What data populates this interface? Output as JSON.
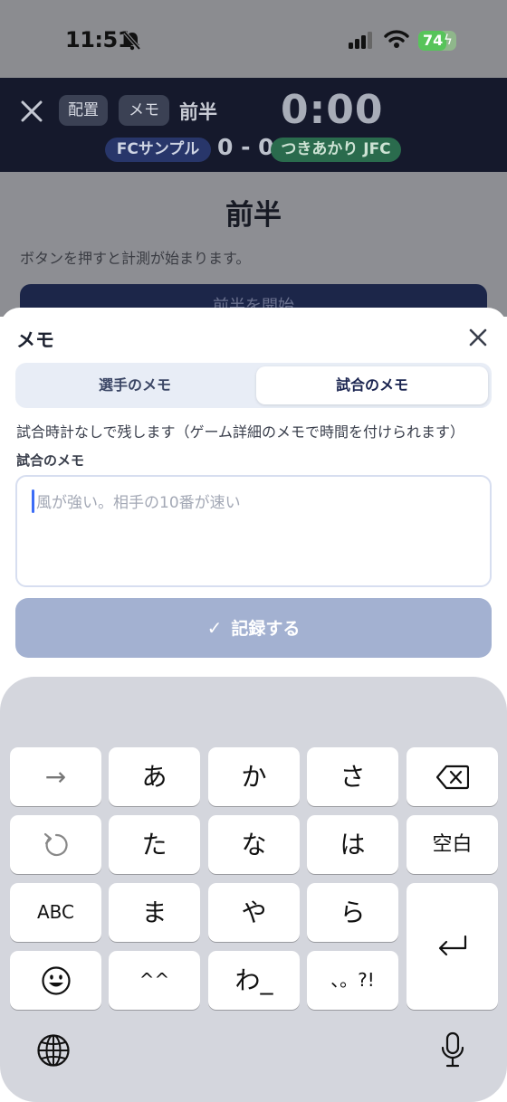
{
  "status_bar": {
    "time": "11:51",
    "battery": "74",
    "battery_fraction": 0.74
  },
  "match_header": {
    "lineup_button": "配置",
    "memo_button": "メモ",
    "period": "前半",
    "clock": "0:00",
    "home_team": "FCサンプル",
    "score": "0 - 0",
    "away_team": "つきあかり JFC"
  },
  "background": {
    "period_title": "前半",
    "hint": "ボタンを押すと計測が始まります。",
    "start_button": "前半を開始"
  },
  "memo_sheet": {
    "title": "メモ",
    "tabs": [
      {
        "label": "選手のメモ",
        "selected": false
      },
      {
        "label": "試合のメモ",
        "selected": true
      }
    ],
    "description": "試合時計なしで残します（ゲーム詳細のメモで時間を付けられます）",
    "field_label": "試合のメモ",
    "placeholder": "風が強い。相手の10番が速い",
    "submit_label": "記録する"
  },
  "keyboard": {
    "row1": [
      "→",
      "あ",
      "か",
      "さ",
      "backspace"
    ],
    "row2": [
      "undo",
      "た",
      "な",
      "は",
      "空白"
    ],
    "row3": [
      "ABC",
      "ま",
      "や",
      "ら"
    ],
    "row4": [
      "emoji",
      "^^",
      "わ_",
      "、。?!"
    ],
    "enter": "return",
    "globe": "globe",
    "mic": "microphone"
  },
  "colors": {
    "header_navy": "#15192c",
    "home_team": "#28366a",
    "away_team": "#2a6b4d",
    "submit_disabled": "#a3b1d1",
    "caret": "#3b6cf6"
  }
}
